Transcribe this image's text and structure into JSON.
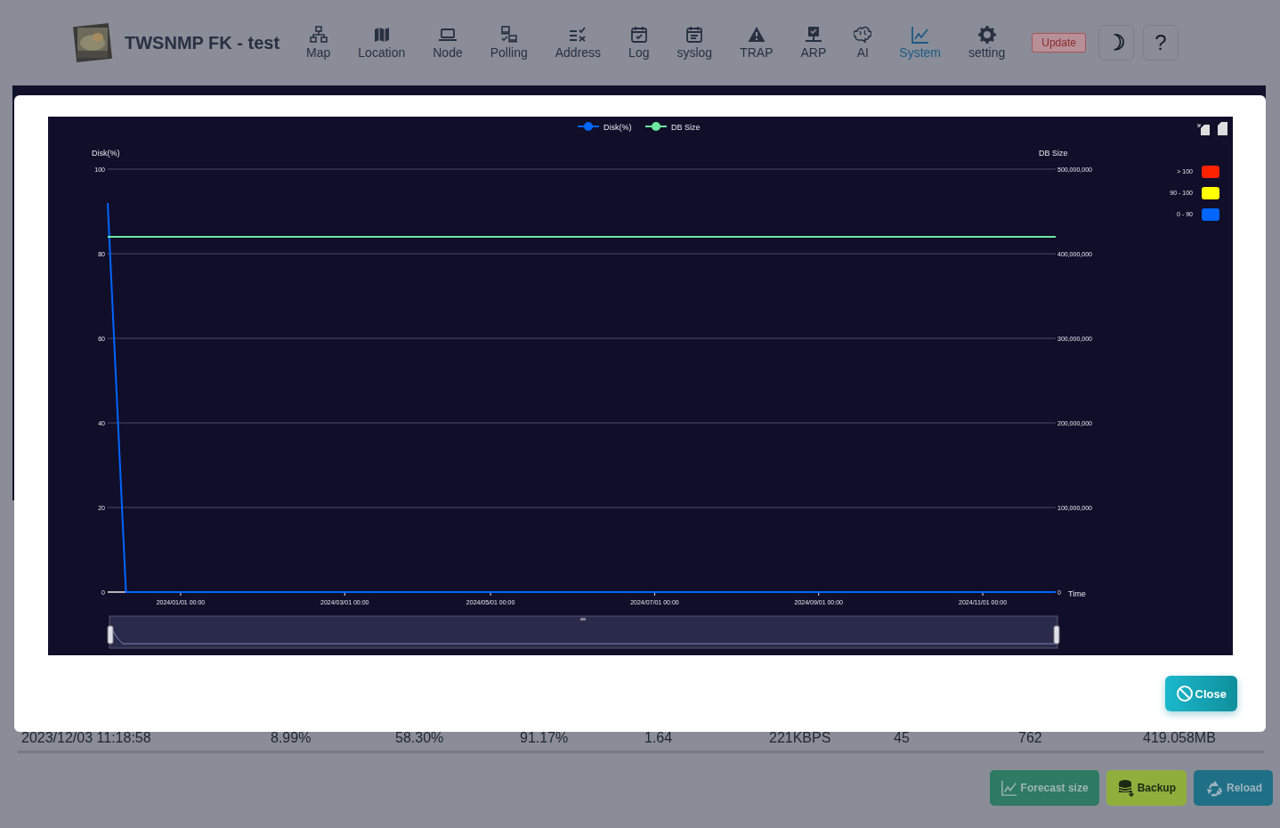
{
  "header": {
    "title": "TWSNMP FK - test",
    "nav": [
      {
        "label": "Map",
        "selected": false
      },
      {
        "label": "Location",
        "selected": false
      },
      {
        "label": "Node",
        "selected": false
      },
      {
        "label": "Polling",
        "selected": false
      },
      {
        "label": "Address",
        "selected": false
      },
      {
        "label": "Log",
        "selected": false
      },
      {
        "label": "syslog",
        "selected": false
      },
      {
        "label": "TRAP",
        "selected": false
      },
      {
        "label": "ARP",
        "selected": false
      },
      {
        "label": "AI",
        "selected": false
      },
      {
        "label": "System",
        "selected": true
      },
      {
        "label": "setting",
        "selected": false
      }
    ],
    "update_button": "Update",
    "theme_button": "☽",
    "help_button": "?"
  },
  "table": {
    "rows": [
      [
        "2023/12/03 11:18:58",
        "8.99%",
        "58.30%",
        "91.17%",
        "1.64",
        "221KBPS",
        "45",
        "762",
        "419.058MB"
      ]
    ]
  },
  "actions": [
    {
      "label": "Forecast size",
      "kind": "forecast"
    },
    {
      "label": "Backup",
      "kind": "backup"
    },
    {
      "label": "Reload",
      "kind": "reload"
    }
  ],
  "dialog": {
    "chart_data": {
      "type": "line",
      "ylabel": "Disk(%)",
      "y2label": "DB Size",
      "xlabel": "Time",
      "grid": true,
      "legend": "top",
      "categories": [
        null,
        null,
        null,
        null,
        "2024/01/01 00:00",
        null,
        null,
        null,
        null,
        null,
        null,
        null,
        null,
        "2024/03/01 00:00",
        null,
        null,
        null,
        null,
        null,
        null,
        null,
        "2024/05/01 00:00",
        null,
        null,
        null,
        null,
        null,
        null,
        null,
        null,
        "2024/07/01 00:00",
        null,
        null,
        null,
        null,
        null,
        null,
        null,
        null,
        "2024/09/01 00:00",
        null,
        null,
        null,
        null,
        null,
        null,
        null,
        null,
        "2024/11/01 00:00",
        null,
        null,
        null,
        null
      ],
      "ylim": [
        0,
        100
      ],
      "y2lim": [
        0,
        500000000
      ],
      "yticks": [
        0,
        20,
        40,
        60,
        80,
        100
      ],
      "y2ticks": [
        {
          "value": 0,
          "label": "0"
        },
        {
          "value": 100000000,
          "label": "100,000,000"
        },
        {
          "value": 200000000,
          "label": "200,000,000"
        },
        {
          "value": 300000000,
          "label": "300,000,000"
        },
        {
          "value": 400000000,
          "label": "400,000,000"
        },
        {
          "value": 500000000,
          "label": "500,000,000"
        }
      ],
      "series": [
        {
          "name": "Disk(%)",
          "color": "#0066ff",
          "values": [
            92,
            0,
            0,
            0,
            0,
            0,
            0,
            0,
            0,
            0,
            0,
            0,
            0,
            0,
            0,
            0,
            0,
            0,
            0,
            0,
            0,
            0,
            0,
            0,
            0,
            0,
            0,
            0,
            0,
            0,
            0,
            0,
            0,
            0,
            0,
            0,
            0,
            0,
            0,
            0,
            0,
            0,
            0,
            0,
            0,
            0,
            0,
            0,
            0,
            0,
            0,
            0,
            0
          ]
        },
        {
          "name": "DB Size",
          "color": "#6ee7a0",
          "axis": "y2",
          "values": [
            420000000,
            420000000,
            420000000,
            420000000,
            420000000,
            420000000,
            420000000,
            420000000,
            420000000,
            420000000,
            420000000,
            420000000,
            420000000,
            420000000,
            420000000,
            420000000,
            420000000,
            420000000,
            420000000,
            420000000,
            420000000,
            420000000,
            420000000,
            420000000,
            420000000,
            420000000,
            420000000,
            420000000,
            420000000,
            420000000,
            420000000,
            420000000,
            420000000,
            420000000,
            420000000,
            420000000,
            420000000,
            420000000,
            420000000,
            420000000,
            420000000,
            420000000,
            420000000,
            420000000,
            420000000,
            420000000,
            420000000,
            420000000,
            420000000,
            420000000,
            420000000,
            420000000,
            420000000
          ]
        }
      ]
    },
    "visual_map": [
      {
        "label": "> 100",
        "color": "#ff2200"
      },
      {
        "label": "90 - 100",
        "color": "#ffff00"
      },
      {
        "label": "0 - 90",
        "color": "#0066ff"
      }
    ],
    "close_button": "Close"
  }
}
